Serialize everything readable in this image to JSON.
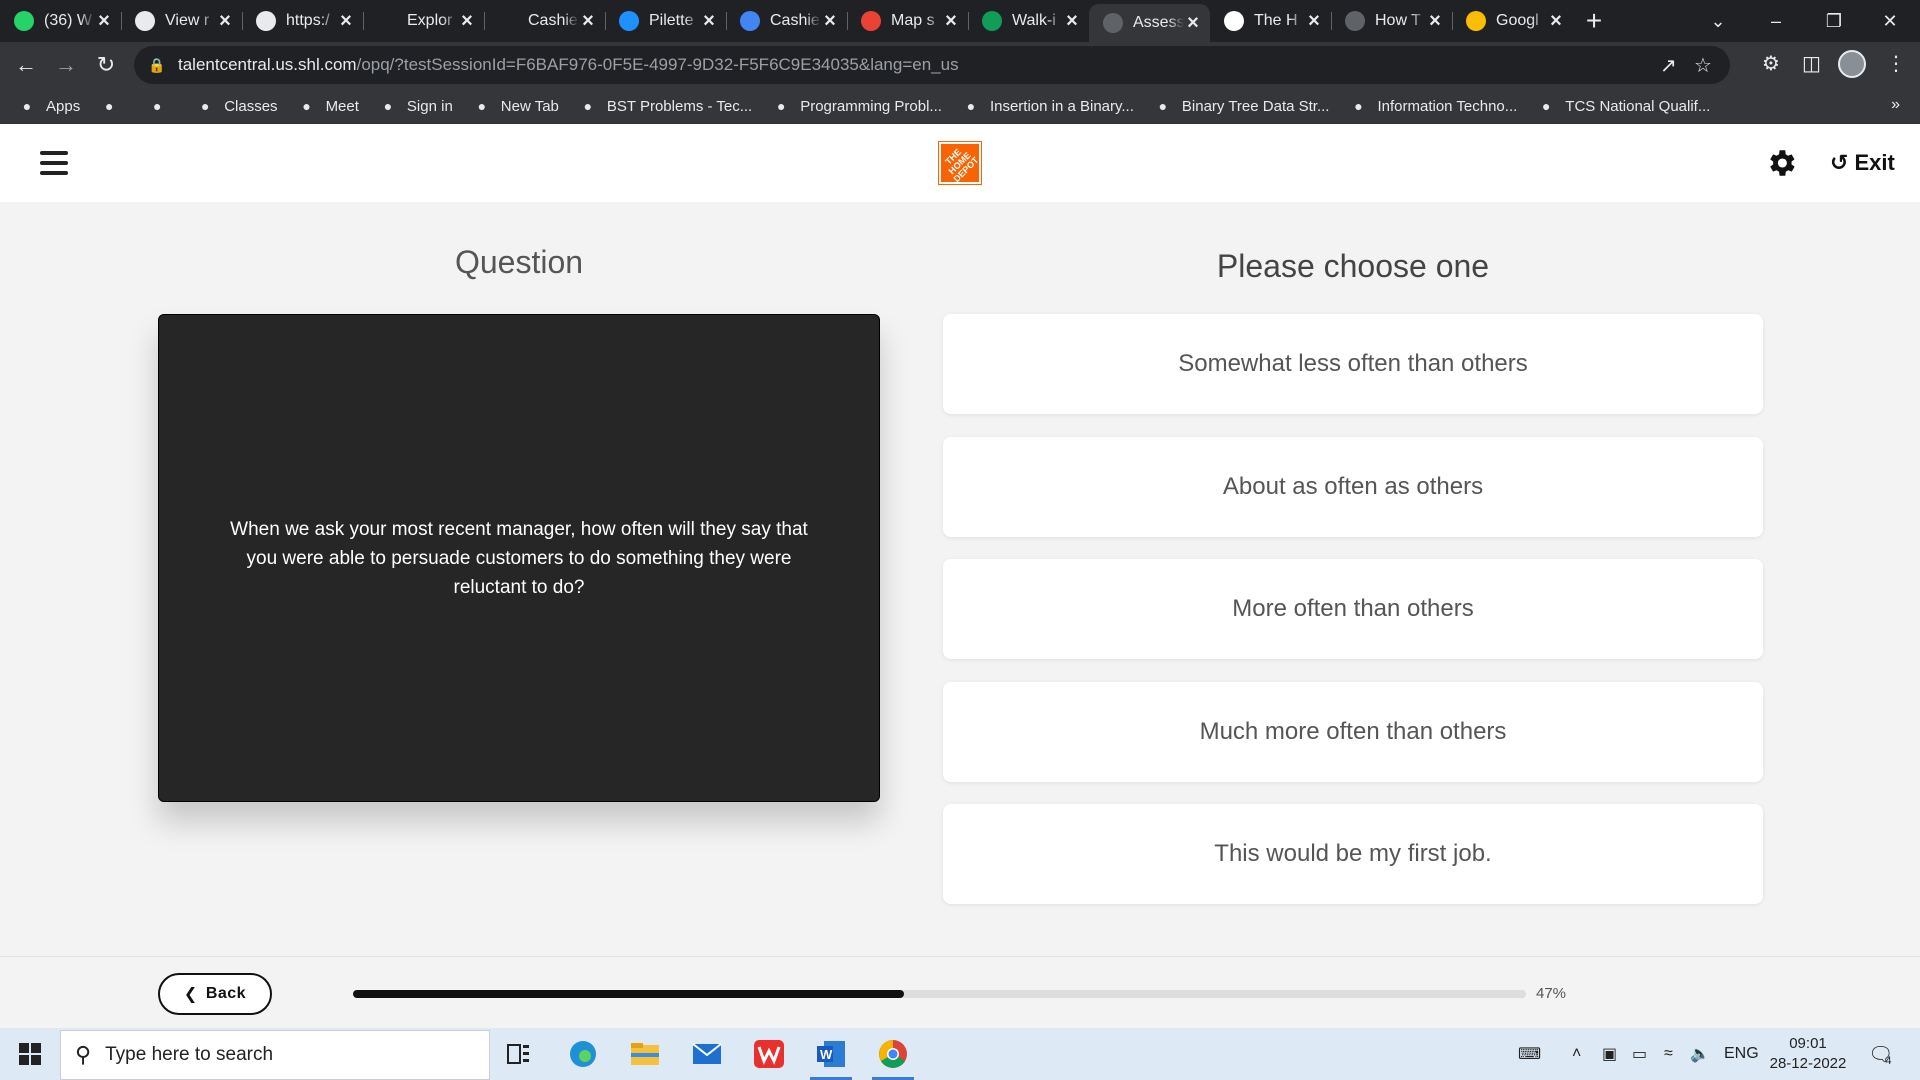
{
  "browser": {
    "tabs": [
      {
        "title": "(36) W",
        "icon": "whatsapp-icon",
        "color": "#25d366"
      },
      {
        "title": "View r",
        "icon": "globe-icon",
        "color": "#e8eaed"
      },
      {
        "title": "https:/",
        "icon": "site-icon",
        "color": "#e8eaed"
      },
      {
        "title": "Explor",
        "icon": "j-icon",
        "color": "#202124"
      },
      {
        "title": "Cashie",
        "icon": "j-icon",
        "color": "#202124"
      },
      {
        "title": "Pilette",
        "icon": "loading-icon",
        "color": "#1e90ff"
      },
      {
        "title": "Cashie",
        "icon": "map-pin-icon",
        "color": "#4285f4"
      },
      {
        "title": "Map s",
        "icon": "gmail-icon",
        "color": "#ea4335"
      },
      {
        "title": "Walk-i",
        "icon": "plus-square-icon",
        "color": "#0f9d58"
      },
      {
        "title": "Assess",
        "icon": "s-icon",
        "color": "#5f6368"
      },
      {
        "title": "The H",
        "icon": "google-icon",
        "color": "#ffffff"
      },
      {
        "title": "How T",
        "icon": "c-icon",
        "color": "#5f6368"
      },
      {
        "title": "Googl",
        "icon": "maps-icon",
        "color": "#fbbc04"
      }
    ],
    "active_tab_index": 9,
    "url_host": "talentcentral.us.shl.com",
    "url_path": "/opq/?testSessionId=F6BAF976-0F5E-4997-9D32-F5F6C9E34035&lang=en_us",
    "bookmarks": [
      {
        "label": "Apps",
        "icon": "apps-grid-icon"
      },
      {
        "label": "",
        "icon": "globe-icon"
      },
      {
        "label": "",
        "icon": "globe-icon"
      },
      {
        "label": "Classes",
        "icon": "classroom-icon"
      },
      {
        "label": "Meet",
        "icon": "meet-icon"
      },
      {
        "label": "Sign in",
        "icon": "google-icon"
      },
      {
        "label": "New Tab",
        "icon": "globe-icon"
      },
      {
        "label": "BST Problems - Tec...",
        "icon": "td-icon"
      },
      {
        "label": "Programming Probl...",
        "icon": "gfg-icon"
      },
      {
        "label": "Insertion in a Binary...",
        "icon": "gfg-icon"
      },
      {
        "label": "Binary Tree Data Str...",
        "icon": "gfg-icon"
      },
      {
        "label": "Information Techno...",
        "icon": "doc-icon"
      },
      {
        "label": "TCS National Qualif...",
        "icon": "power-icon"
      }
    ]
  },
  "app": {
    "exit_label": "Exit",
    "brand_color": "#f96302",
    "logo_text": "THE HOME DEPOT"
  },
  "question": {
    "heading": "Question",
    "text": "When we ask your most recent manager, how often will they say that you were able to persuade customers to do something they were reluctant to do?"
  },
  "answers": {
    "heading": "Please choose one",
    "options": [
      "Somewhat less often than others",
      "About as often as others",
      "More often than others",
      "Much more often than others",
      "This would be my first job."
    ]
  },
  "footer": {
    "back_label": "Back",
    "progress_percent": 47,
    "progress_label": "47%"
  },
  "taskbar": {
    "search_placeholder": "Type here to search",
    "language": "ENG",
    "time": "09:01",
    "date": "28-12-2022",
    "notification_count": "4"
  }
}
